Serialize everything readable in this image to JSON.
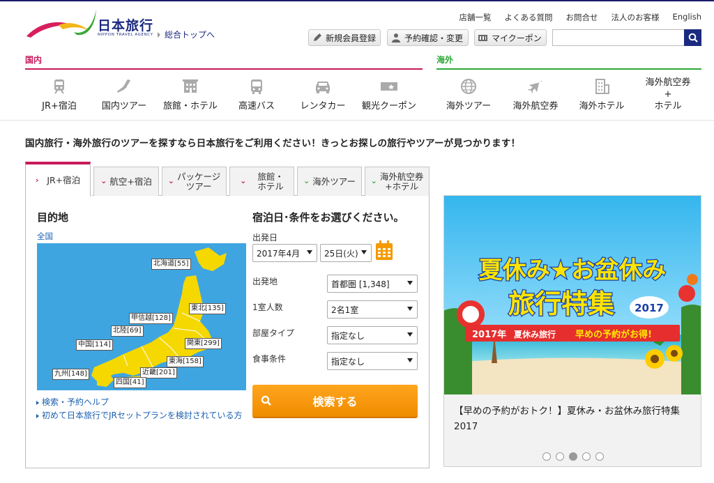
{
  "header": {
    "logo_text": "日本旅行",
    "logo_sub": "NIPPON TRAVEL AGENCY",
    "home_link": "総合トップへ",
    "util_links": [
      "店舗一覧",
      "よくある質問",
      "お問合せ",
      "法人のお客様",
      "English"
    ],
    "account_buttons": [
      "新規会員登録",
      "予約確認・変更",
      "マイクーポン"
    ],
    "search_placeholder": ""
  },
  "nav": {
    "domestic_label": "国内",
    "overseas_label": "海外",
    "domestic_color": "#c8195a",
    "overseas_color": "#2ea836",
    "items": [
      {
        "label": "JR+宿泊",
        "icon": "train-icon"
      },
      {
        "label": "国内ツアー",
        "icon": "japan-map-icon"
      },
      {
        "label": "旅館・ホテル",
        "icon": "hotel-icon"
      },
      {
        "label": "高速バス",
        "icon": "bus-icon"
      },
      {
        "label": "レンタカー",
        "icon": "car-icon"
      },
      {
        "label": "観光クーポン",
        "icon": "ticket-icon"
      },
      {
        "label": "海外ツアー",
        "icon": "globe-icon"
      },
      {
        "label": "海外航空券",
        "icon": "airplane-icon"
      },
      {
        "label": "海外ホテル",
        "icon": "building-icon"
      },
      {
        "label_lines": [
          "海外航空券",
          "+",
          "ホテル"
        ],
        "icon": ""
      }
    ]
  },
  "intro": "国内旅行・海外旅行のツアーを探すなら日本旅行をご利用ください！きっとお探しの旅行やツアーが見つかります！",
  "tabs": [
    {
      "label": "JR+宿泊",
      "active": true
    },
    {
      "label": "航空+宿泊"
    },
    {
      "label_lines": [
        "パッケージ",
        "ツアー"
      ]
    },
    {
      "label_lines": [
        "旅館・",
        "ホテル"
      ]
    },
    {
      "label": "海外ツアー"
    },
    {
      "label_lines": [
        "海外航空券",
        "+ホテル"
      ]
    }
  ],
  "destination": {
    "title": "目的地",
    "all_link": "全国",
    "regions": [
      {
        "label": "北海道[55]"
      },
      {
        "label": "東北[135]"
      },
      {
        "label": "甲信越[128]"
      },
      {
        "label": "北陸[69]"
      },
      {
        "label": "関東[299]"
      },
      {
        "label": "中国[114]"
      },
      {
        "label": "東海[158]"
      },
      {
        "label": "近畿[201]"
      },
      {
        "label": "九州[148]"
      },
      {
        "label": "四国[41]"
      }
    ],
    "help_links": [
      "検索・予約ヘルプ",
      "初めて日本旅行でJRセットプランを検討されている方"
    ]
  },
  "conditions": {
    "title": "宿泊日･条件をお選びください。",
    "date_label": "出発日",
    "month_value": "2017年4月",
    "day_value": "25日(火)",
    "origin_label": "出発地",
    "origin_value": "首都圏 [1,348]",
    "people_label": "1室人数",
    "people_value": "2名1室",
    "room_label": "部屋タイプ",
    "room_value": "指定なし",
    "meal_label": "食事条件",
    "meal_value": "指定なし",
    "search_button": "検索する"
  },
  "banner": {
    "line1": "夏休み★お盆休み",
    "line2": "旅行特集",
    "year": "2017",
    "ribbon_year": "2017年",
    "ribbon_mid": "夏休み旅行",
    "ribbon_right": "早めの予約がお得!",
    "caption": "【早めの予約がおトク！】夏休み・お盆休み旅行特集2017",
    "dots": 5,
    "active_dot": 2
  }
}
